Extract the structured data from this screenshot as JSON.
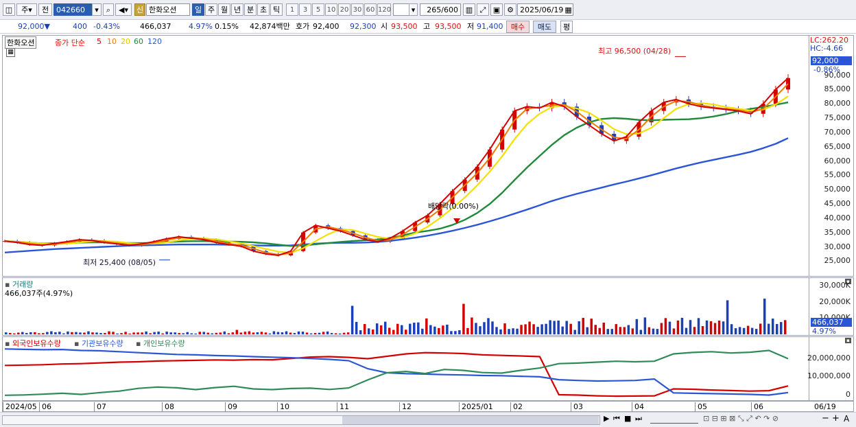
{
  "toolbar": {
    "type_label": "주",
    "mode_label": "전",
    "code_value": "042660",
    "name_badge": "신",
    "stock_name": "한화오션",
    "periods": [
      "일",
      "주",
      "월",
      "년",
      "분",
      "초",
      "틱"
    ],
    "active_period": "일",
    "intervals": [
      "1",
      "3",
      "5",
      "10",
      "20",
      "30",
      "60",
      "120"
    ],
    "count_value": "265",
    "count_total": "/600",
    "date_value": "2025/06/19"
  },
  "quote": {
    "price": "92,000",
    "direction": "▼",
    "change": "400",
    "change_pct": "-0.43%",
    "volume": "466,037",
    "volume_pct": "4.97%",
    "turnover_pct": "0.15%",
    "amount": "42,874백만",
    "hoga_label": "호가",
    "ask": "92,400",
    "bid": "92,300",
    "open_label": "시",
    "open": "93,500",
    "high_label": "고",
    "high": "93,500",
    "low_label": "저",
    "low": "91,400",
    "buy_label": "매수",
    "sell_label": "매도",
    "eval_label": "평"
  },
  "price_panel": {
    "stock_label": "한화오션",
    "ma_title": "종가 단순",
    "ma_periods": [
      "5",
      "10",
      "20",
      "60",
      "120"
    ],
    "ma_colors": [
      "#d40000",
      "#f07a00",
      "#f4e000",
      "#1f8a3a",
      "#2a56d6"
    ],
    "lc_label": "LC:262.20",
    "hc_label": "HC:-4.66",
    "last_price_tag": "92,000",
    "last_change_tag": "-0.86%",
    "high_annotation": "최고 96,500 (04/28)",
    "low_annotation": "최저 25,400 (08/05)",
    "dividend_annotation": "배당락(0.00%)"
  },
  "volume_panel": {
    "title": "거래량",
    "subtitle": "466,037주(4.97%)",
    "last_tag": "466,037",
    "last_pct": "4.97%"
  },
  "holding_panel": {
    "legend": [
      "외국인보유수량",
      "기관보유수량",
      "개인보유수량"
    ],
    "colors": [
      "#d40000",
      "#2a56d6",
      "#2e8b57"
    ]
  },
  "chart_data": [
    {
      "type": "line",
      "title": "한화오션 종가 단순",
      "y_ticks": [
        25000,
        30000,
        35000,
        40000,
        45000,
        50000,
        55000,
        60000,
        65000,
        70000,
        75000,
        80000,
        85000,
        90000
      ],
      "ylim": [
        21000,
        99000
      ],
      "x_labels": [
        "2024/05",
        "06",
        "07",
        "08",
        "09",
        "10",
        "11",
        "12",
        "2025/01",
        "02",
        "03",
        "04",
        "05",
        "06"
      ],
      "grid": false,
      "last_price": 92000,
      "high": {
        "value": 96500,
        "date": "04/28"
      },
      "low": {
        "value": 25400,
        "date": "08/05"
      },
      "series": [
        {
          "name": "5",
          "values": [
            32000,
            31500,
            30800,
            30500,
            31200,
            31800,
            32500,
            32200,
            31500,
            31000,
            30500,
            31000,
            31800,
            32800,
            33500,
            33000,
            32500,
            31500,
            30800,
            30200,
            28500,
            27500,
            27000,
            28500,
            35000,
            37500,
            36500,
            35500,
            34000,
            32500,
            31800,
            33000,
            35500,
            38500,
            41000,
            45000,
            49500,
            53500,
            58000,
            64000,
            71000,
            77500,
            79000,
            78500,
            80500,
            79000,
            75500,
            72500,
            69500,
            67000,
            68500,
            73500,
            77500,
            80500,
            81500,
            80000,
            79000,
            78500,
            78000,
            77500,
            76500,
            80000,
            85000,
            89000
          ]
        },
        {
          "name": "120",
          "values": [
            28000,
            28300,
            28600,
            28900,
            29200,
            29400,
            29600,
            29800,
            30000,
            30200,
            30400,
            30500,
            30600,
            30700,
            30800,
            30800,
            30800,
            30800,
            30700,
            30600,
            30500,
            30400,
            30400,
            30500,
            30800,
            31100,
            31300,
            31400,
            31400,
            31500,
            31700,
            32100,
            32600,
            33200,
            33900,
            34700,
            35600,
            36600,
            37700,
            38900,
            40200,
            41600,
            43000,
            44500,
            46000,
            47300,
            48500,
            49600,
            50700,
            51800,
            52800,
            53900,
            55000,
            56200,
            57400,
            58500,
            59500,
            60400,
            61300,
            62200,
            63200,
            64500,
            66000,
            68000
          ]
        }
      ]
    },
    {
      "type": "bar",
      "title": "거래량",
      "y_ticks": [
        "10,000K",
        "20,000K",
        "30,000K"
      ],
      "ylim": [
        0,
        33000000
      ],
      "last_value": 466037
    },
    {
      "type": "line",
      "title": "보유수량",
      "y_ticks": [
        "0",
        "10,000,000",
        "20,000,000"
      ],
      "ylim": [
        -1500000,
        27000000
      ],
      "series": [
        {
          "name": "외국인보유수량",
          "values": [
            16000000,
            16200000,
            16400000,
            16800000,
            17000000,
            17400000,
            17800000,
            18000000,
            18400000,
            18600000,
            18800000,
            19000000,
            18900000,
            19200000,
            19100000,
            19800000,
            20600000,
            20800000,
            20400000,
            19700000,
            21000000,
            22300000,
            23000000,
            22800000,
            22500000,
            21800000,
            21500000,
            21200000,
            20800000,
            0,
            -200000,
            -600000,
            -800000,
            -700000,
            -600000,
            3200000,
            3000000,
            2600000,
            2300000,
            2000000,
            2200000,
            4800000
          ]
        },
        {
          "name": "기관보유수량",
          "values": [
            25000000,
            24800000,
            24600000,
            24700000,
            24200000,
            24000000,
            23500000,
            23000000,
            22500000,
            22000000,
            21800000,
            21400000,
            21200000,
            20800000,
            20500000,
            20200000,
            19800000,
            19300000,
            18600000,
            14200000,
            12000000,
            11500000,
            11300000,
            11000000,
            10800000,
            10500000,
            10400000,
            10100000,
            9800000,
            8200000,
            7800000,
            7500000,
            7600000,
            7800000,
            8600000,
            1000000,
            800000,
            600000,
            400000,
            200000,
            -200000,
            1200000
          ]
        },
        {
          "name": "개인보유수량",
          "values": [
            -300000,
            -100000,
            300000,
            800000,
            200000,
            1200000,
            2000000,
            3500000,
            4200000,
            3800000,
            2800000,
            3900000,
            4600000,
            3200000,
            2800000,
            3400000,
            3600000,
            2900000,
            3700000,
            8100000,
            12000000,
            12700000,
            11600000,
            13800000,
            13300000,
            12100000,
            11800000,
            13300000,
            14600000,
            17000000,
            17300000,
            17800000,
            18300000,
            18000000,
            18300000,
            22300000,
            23100000,
            23500000,
            22800000,
            23200000,
            24200000,
            19700000
          ]
        }
      ]
    }
  ]
}
